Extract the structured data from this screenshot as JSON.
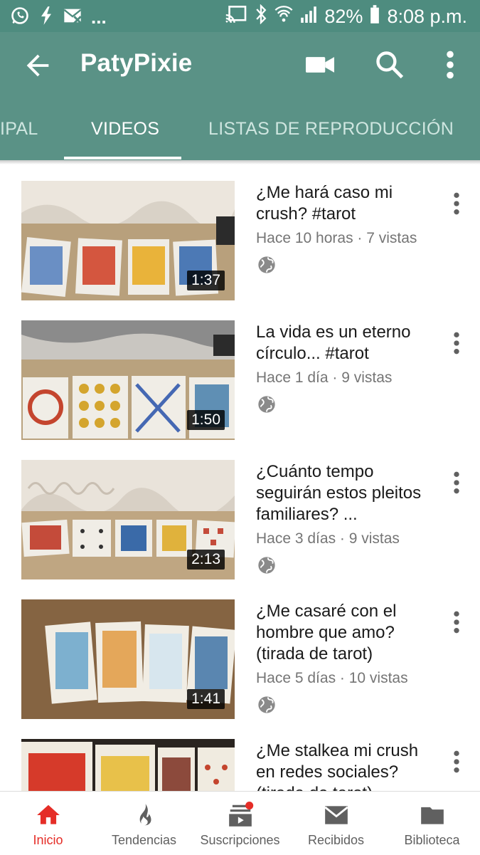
{
  "status_bar": {
    "battery": "82%",
    "time": "8:08 p.m.",
    "more_indicator": "...",
    "icons": [
      "whatsapp-icon",
      "flash-icon",
      "mail-off-icon",
      "cast-icon",
      "bluetooth-icon",
      "wifi-call-icon",
      "signal-icon",
      "battery-icon"
    ]
  },
  "app_bar": {
    "title": "PatyPixie",
    "icons": [
      "back-arrow-icon",
      "video-camera-icon",
      "search-icon",
      "more-vert-icon"
    ],
    "color": "#5a9286"
  },
  "tabs": [
    {
      "label": "IPAL",
      "active": false
    },
    {
      "label": "VIDEOS",
      "active": true
    },
    {
      "label": "LISTAS DE REPRODUCCIÓN",
      "active": false
    }
  ],
  "videos": [
    {
      "title": "¿Me hará caso mi crush? #tarot",
      "meta": "Hace 10 horas · 7 vistas",
      "duration": "1:37"
    },
    {
      "title": "La vida es un eterno círculo... #tarot",
      "meta": "Hace 1 día · 9 vistas",
      "duration": "1:50"
    },
    {
      "title": "¿Cuánto tempo seguirán estos pleitos familiares? ...",
      "meta": "Hace 3 días · 9 vistas",
      "duration": "2:13"
    },
    {
      "title": "¿Me casaré con el hombre que amo? (tirada de tarot)",
      "meta": "Hace 5 días · 10 vistas",
      "duration": "1:41"
    },
    {
      "title": "¿Me stalkea mi crush en redes sociales? (tirada de tarot)",
      "meta": "",
      "duration": ""
    }
  ],
  "bottom_nav": [
    {
      "label": "Inicio",
      "icon": "home-icon",
      "active": true
    },
    {
      "label": "Tendencias",
      "icon": "flame-icon",
      "active": false
    },
    {
      "label": "Suscripciones",
      "icon": "subscriptions-icon",
      "active": false
    },
    {
      "label": "Recibidos",
      "icon": "inbox-icon",
      "active": false
    },
    {
      "label": "Biblioteca",
      "icon": "folder-icon",
      "active": false
    }
  ],
  "colors": {
    "accent": "#e52d27",
    "status_bar": "#4e8c7f",
    "meta_text": "#757575"
  }
}
